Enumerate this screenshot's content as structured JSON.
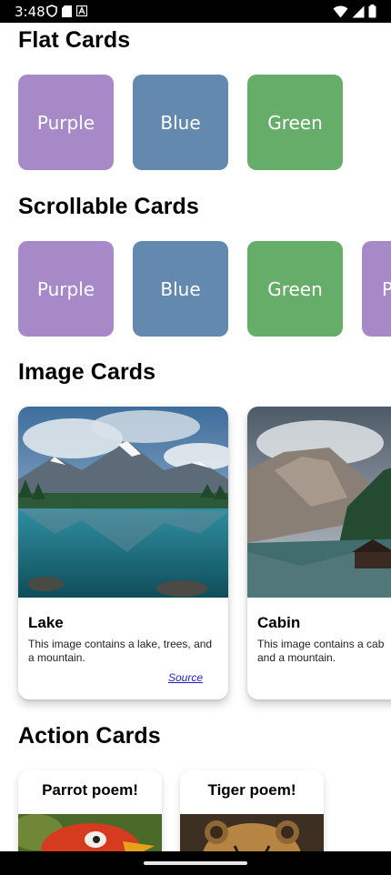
{
  "status_bar": {
    "time": "3:48",
    "left_icons": [
      "shield-icon",
      "sd-card-icon",
      "a-badge-icon"
    ],
    "right_icons": [
      "wifi-icon",
      "cellular-signal-icon",
      "battery-icon"
    ]
  },
  "sections": {
    "flat": {
      "title": "Flat Cards"
    },
    "scrollable": {
      "title": "Scrollable Cards"
    },
    "image": {
      "title": "Image Cards"
    },
    "action": {
      "title": "Action Cards"
    }
  },
  "flat_cards": [
    {
      "label": "Purple",
      "color": "#A789C7"
    },
    {
      "label": "Blue",
      "color": "#6489AF"
    },
    {
      "label": "Green",
      "color": "#66AD69"
    }
  ],
  "scrollable_cards": [
    {
      "label": "Purple",
      "color": "#A789C7"
    },
    {
      "label": "Blue",
      "color": "#6489AF"
    },
    {
      "label": "Green",
      "color": "#66AD69"
    },
    {
      "label": "P",
      "color": "#A789C7"
    }
  ],
  "image_cards": [
    {
      "title": "Lake",
      "description": "This image contains a lake, trees, and a mountain.",
      "source_label": "Source"
    },
    {
      "title": "Cabin",
      "description": "This image contains a cab and a mountain."
    }
  ],
  "action_cards": [
    {
      "title": "Parrot poem!"
    },
    {
      "title": "Tiger poem!"
    }
  ]
}
